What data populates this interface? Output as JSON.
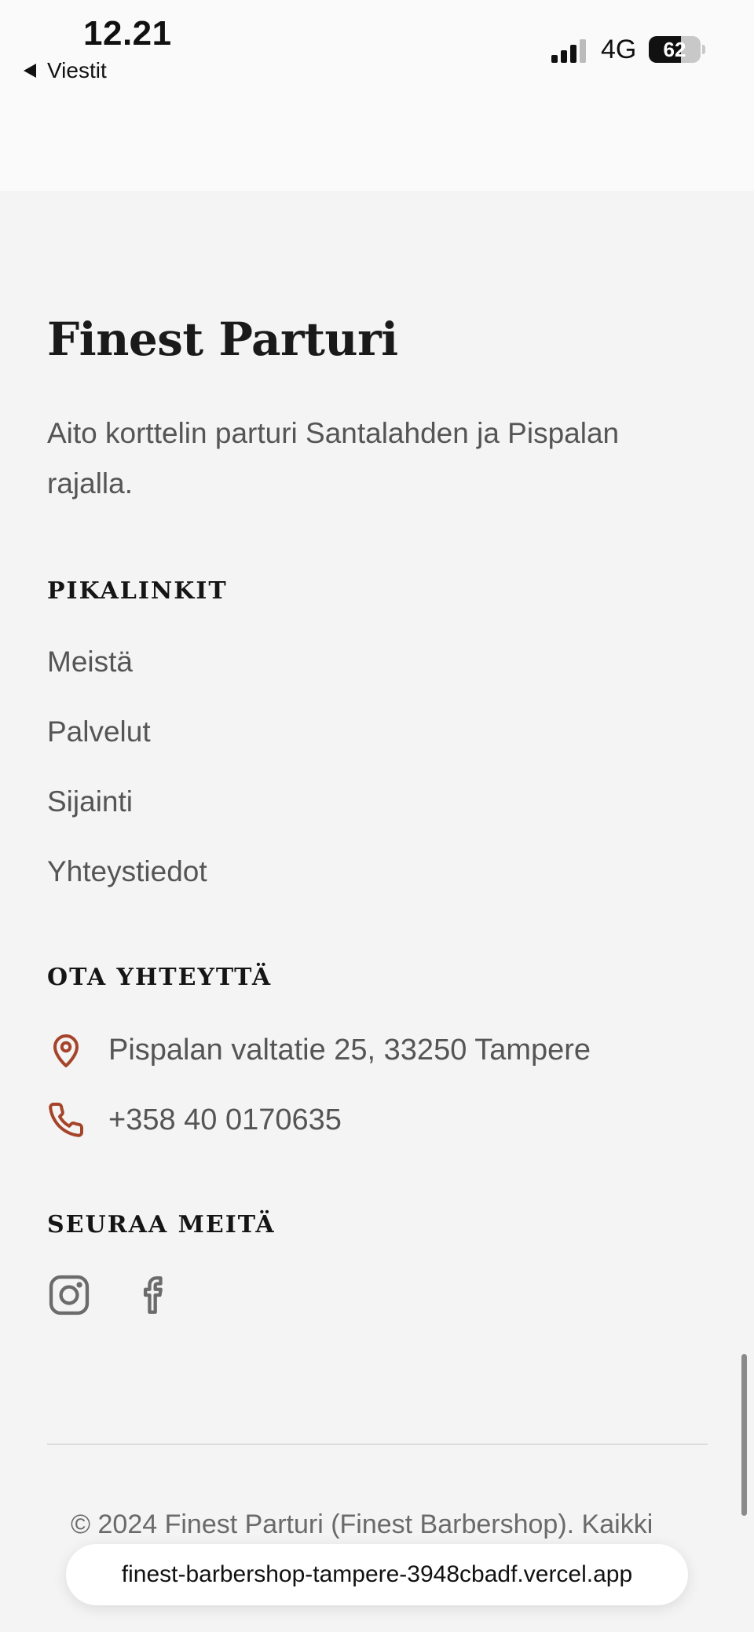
{
  "status_bar": {
    "time": "12.21",
    "back_label": "Viestit",
    "network": "4G",
    "battery_level": "62",
    "battery_fraction": 0.62,
    "signal_bars_active": 3,
    "signal_bars_total": 4
  },
  "footer": {
    "brand_name": "Finest Parturi",
    "tagline": "Aito korttelin parturi Santalahden ja Pispalan rajalla.",
    "quick_links": {
      "heading": "PIKALINKIT",
      "items": [
        {
          "label": "Meistä"
        },
        {
          "label": "Palvelut"
        },
        {
          "label": "Sijainti"
        },
        {
          "label": "Yhteystiedot"
        }
      ]
    },
    "contact": {
      "heading": "OTA YHTEYTTÄ",
      "address": "Pispalan valtatie 25, 33250 Tampere",
      "phone": "+358 40 0170635",
      "address_icon": "map-pin-icon",
      "phone_icon": "phone-icon"
    },
    "social": {
      "heading": "SEURAA MEITÄ",
      "icons": [
        "instagram-icon",
        "facebook-icon"
      ]
    },
    "copyright": "© 2024 Finest Parturi (Finest Barbershop). Kaikki"
  },
  "browser": {
    "url": "finest-barbershop-tampere-3948cbadf.vercel.app"
  },
  "colors": {
    "accent": "#a5442a",
    "background": "#f4f4f4",
    "icon_gray": "#6b6b6b"
  }
}
